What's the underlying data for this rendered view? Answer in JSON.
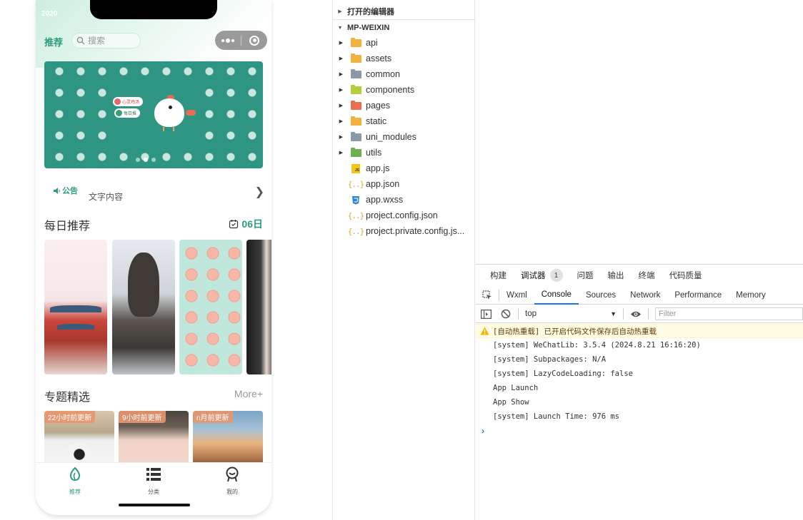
{
  "phone": {
    "status_year": "2020",
    "nav_title": "推荐",
    "search_placeholder": "搜索",
    "banner_pills": [
      "心灵鸡汤",
      "每日推"
    ],
    "notice_label": "公告",
    "notice_text": "文字内容",
    "daily_title": "每日推荐",
    "daily_date": "06日",
    "topic_title": "专题精选",
    "topic_more": "More+",
    "topic_tags": [
      "22小时前更新",
      "9小时前更新",
      "n月前更新"
    ],
    "tabs": [
      {
        "label": "推荐",
        "icon": "leaf-icon",
        "active": true
      },
      {
        "label": "分类",
        "icon": "list-icon",
        "active": false
      },
      {
        "label": "我的",
        "icon": "user-icon",
        "active": false
      }
    ]
  },
  "explorer": {
    "open_editors": "打开的编辑器",
    "project": "MP-WEIXIN",
    "items": [
      {
        "label": "api",
        "kind": "folder",
        "color": "#f2b23e"
      },
      {
        "label": "assets",
        "kind": "folder",
        "color": "#f2b23e"
      },
      {
        "label": "common",
        "kind": "folder",
        "color": "#8a9aa8"
      },
      {
        "label": "components",
        "kind": "folder",
        "color": "#b6cd3e"
      },
      {
        "label": "pages",
        "kind": "folder",
        "color": "#e86f52"
      },
      {
        "label": "static",
        "kind": "folder",
        "color": "#f2b23e"
      },
      {
        "label": "uni_modules",
        "kind": "folder",
        "color": "#8a9aa8"
      },
      {
        "label": "utils",
        "kind": "folder",
        "color": "#6cb04f"
      },
      {
        "label": "app.js",
        "kind": "js"
      },
      {
        "label": "app.json",
        "kind": "json"
      },
      {
        "label": "app.wxss",
        "kind": "css"
      },
      {
        "label": "project.config.json",
        "kind": "json"
      },
      {
        "label": "project.private.config.js...",
        "kind": "json"
      }
    ]
  },
  "debugger": {
    "top_tabs": [
      "构建",
      "调试器",
      "问题",
      "输出",
      "终端",
      "代码质量"
    ],
    "active_top_tab": "调试器",
    "badge_count": "1",
    "dev_tabs": [
      "Wxml",
      "Console",
      "Sources",
      "Network",
      "Performance",
      "Memory"
    ],
    "active_dev_tab": "Console",
    "context": "top",
    "filter_placeholder": "Filter",
    "warning": "[自动热重载] 已开启代码文件保存后自动热重载",
    "lines": [
      "[system] WeChatLib: 3.5.4 (2024.8.21 16:16:20)",
      "[system] Subpackages: N/A",
      "[system] LazyCodeLoading: false",
      "App Launch",
      "App Show",
      "[system] Launch Time: 976 ms"
    ]
  },
  "colors": {
    "brand_green": "#2e9a7c",
    "devtools_blue": "#1a73e8",
    "warning_bg": "#fffbe5"
  }
}
